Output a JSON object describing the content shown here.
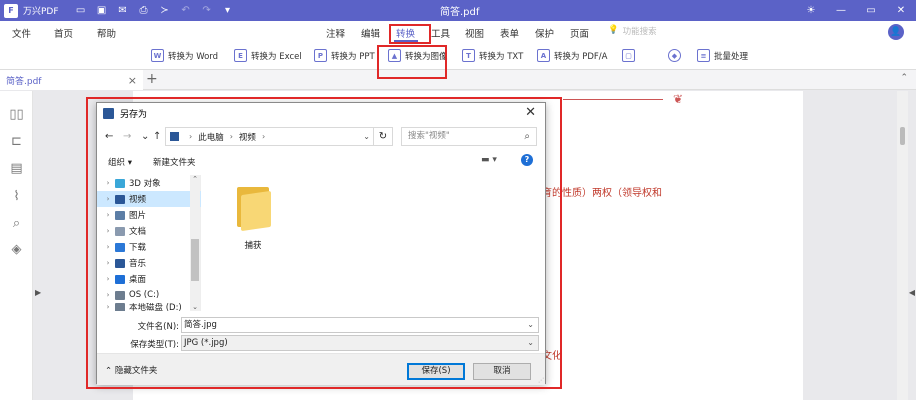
{
  "titlebar": {
    "app_name": "万兴PDF",
    "doc_title": "简答.pdf",
    "win_min": "—",
    "win_max": "▭",
    "win_close": "✕"
  },
  "menu": {
    "items": [
      "文件",
      "首页",
      "帮助",
      "注释",
      "编辑",
      "转换",
      "工具",
      "视图",
      "表单",
      "保护",
      "页面"
    ],
    "active": "转换",
    "search_placeholder": "功能搜索",
    "avatar": "👤"
  },
  "ribbon": {
    "buttons": [
      {
        "icon": "word-icon",
        "glyph": "W",
        "label": "转换为 Word"
      },
      {
        "icon": "excel-icon",
        "glyph": "E",
        "label": "转换为 Excel"
      },
      {
        "icon": "ppt-icon",
        "glyph": "P",
        "label": "转换为 PPT"
      },
      {
        "icon": "image-icon",
        "glyph": "▲",
        "label": "转换为图像"
      },
      {
        "icon": "txt-icon",
        "glyph": "T",
        "label": "转换为 TXT"
      },
      {
        "icon": "pdfa-icon",
        "glyph": "A",
        "label": "转换为 PDF/A"
      },
      {
        "icon": "more-icon",
        "glyph": "▢",
        "label": ""
      },
      {
        "icon": "batch-icon",
        "glyph": "◆",
        "label": "批量处理"
      }
    ]
  },
  "tabs": {
    "doc_tab": "简答.pdf",
    "close": "×",
    "add": "+"
  },
  "document": {
    "line1": "育的性质）两权（领导权和",
    "line2": "文化"
  },
  "dialog": {
    "title": "另存为",
    "nav_back": "←",
    "nav_forward": "→",
    "nav_recent": "⌄",
    "nav_up": "↑",
    "path": [
      "此电脑",
      "视频"
    ],
    "search_placeholder": "搜索\"视频\"",
    "organize": "组织 ▾",
    "new_folder": "新建文件夹",
    "view_toggle": "▬ ▾",
    "help": "?",
    "tree": [
      {
        "label": "3D 对象",
        "icon_color": "#3aa7d8"
      },
      {
        "label": "视频",
        "icon_color": "#2b5797",
        "selected": true
      },
      {
        "label": "图片",
        "icon_color": "#5c7ea6"
      },
      {
        "label": "文档",
        "icon_color": "#8a9aaf"
      },
      {
        "label": "下载",
        "icon_color": "#2b78d7"
      },
      {
        "label": "音乐",
        "icon_color": "#2b5797"
      },
      {
        "label": "桌面",
        "icon_color": "#1e6fd6"
      },
      {
        "label": "OS (C:)",
        "icon_color": "#6d7d8f"
      },
      {
        "label": "本地磁盘 (D:)",
        "icon_color": "#6d7d8f"
      }
    ],
    "folders": [
      {
        "label": "捕获"
      }
    ],
    "filename_label": "文件名(N):",
    "filename_value": "简答.jpg",
    "filetype_label": "保存类型(T):",
    "filetype_value": "JPG (*.jpg)",
    "hide_folders": "隐藏文件夹",
    "save_button": "保存(S)",
    "cancel_button": "取消"
  },
  "colors": {
    "accent": "#5b62c7",
    "highlight": "#e02828",
    "doc_text": "#c0392b"
  }
}
